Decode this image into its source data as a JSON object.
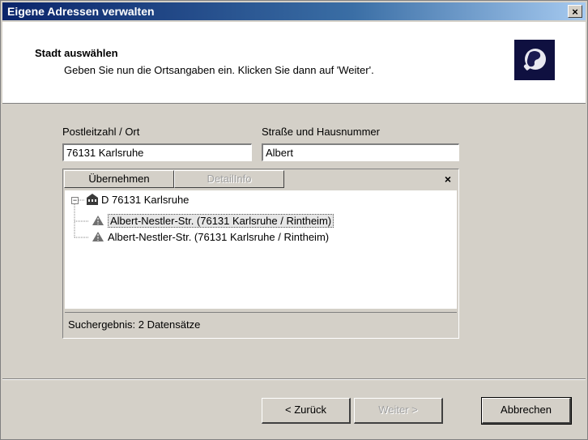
{
  "window": {
    "title": "Eigene Adressen verwalten",
    "close_label": "×"
  },
  "header": {
    "title": "Stadt auswählen",
    "subtitle": "Geben Sie nun die Ortsangaben ein. Klicken Sie dann auf 'Weiter'.",
    "icon": "globe-icon"
  },
  "form": {
    "postal_label": "Postleitzahl / Ort",
    "postal_value": "76131 Karlsruhe",
    "street_label": "Straße und Hausnummer",
    "street_value": "Albert"
  },
  "result_panel": {
    "apply_label": "Übernehmen",
    "detail_label": "DetailInfo",
    "close_label": "×",
    "tree": {
      "root": "D 76131 Karlsruhe",
      "items": [
        "Albert-Nestler-Str. (76131 Karlsruhe / Rintheim)",
        "Albert-Nestler-Str. (76131 Karlsruhe / Rintheim)"
      ]
    },
    "status": "Suchergebnis: 2 Datensätze"
  },
  "buttons": {
    "back_label": "< Zurück",
    "next_label": "Weiter >",
    "cancel_label": "Abbrechen"
  },
  "colors": {
    "titlebar_start": "#0a246a",
    "titlebar_end": "#a6caf0",
    "face": "#d4d0c8",
    "header_icon_bg": "#0f1040"
  }
}
